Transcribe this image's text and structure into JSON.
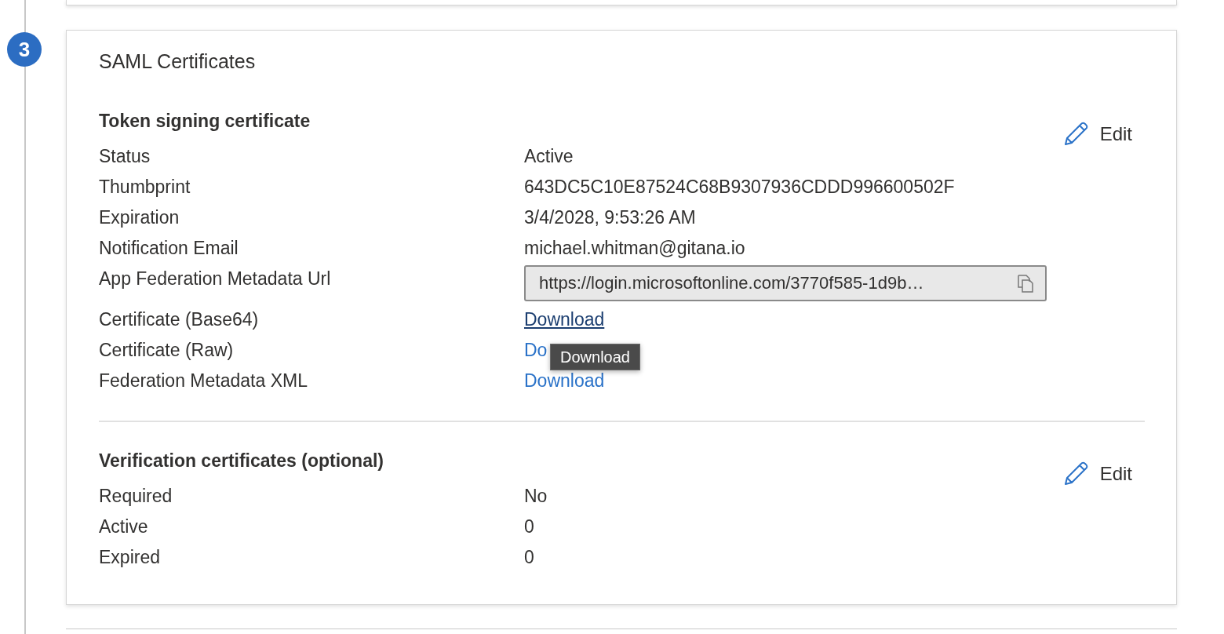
{
  "step": "3",
  "section": {
    "title": "SAML Certificates",
    "groups": [
      {
        "title": "Token signing certificate",
        "edit": "Edit",
        "rows": [
          {
            "label": "Status",
            "kind": "text",
            "value": "Active"
          },
          {
            "label": "Thumbprint",
            "kind": "text",
            "value": "643DC5C10E87524C68B9307936CDDD996600502F"
          },
          {
            "label": "Expiration",
            "kind": "text",
            "value": "3/4/2028, 9:53:26 AM"
          },
          {
            "label": "Notification Email",
            "kind": "text",
            "value": "michael.whitman@gitana.io"
          },
          {
            "label": "App Federation Metadata Url",
            "kind": "field",
            "value": "https://login.microsoftonline.com/3770f585-1d9b…"
          },
          {
            "label": "Certificate (Base64)",
            "kind": "link",
            "value": "Download",
            "hovered": true,
            "tooltip": "Download"
          },
          {
            "label": "Certificate (Raw)",
            "kind": "link",
            "value": "Do",
            "hovered": false
          },
          {
            "label": "Federation Metadata XML",
            "kind": "link",
            "value": "Download",
            "hovered": false
          }
        ]
      },
      {
        "title": "Verification certificates (optional)",
        "edit": "Edit",
        "rows": [
          {
            "label": "Required",
            "kind": "text",
            "value": "No"
          },
          {
            "label": "Active",
            "kind": "text",
            "value": "0"
          },
          {
            "label": "Expired",
            "kind": "text",
            "value": "0"
          }
        ]
      }
    ]
  }
}
